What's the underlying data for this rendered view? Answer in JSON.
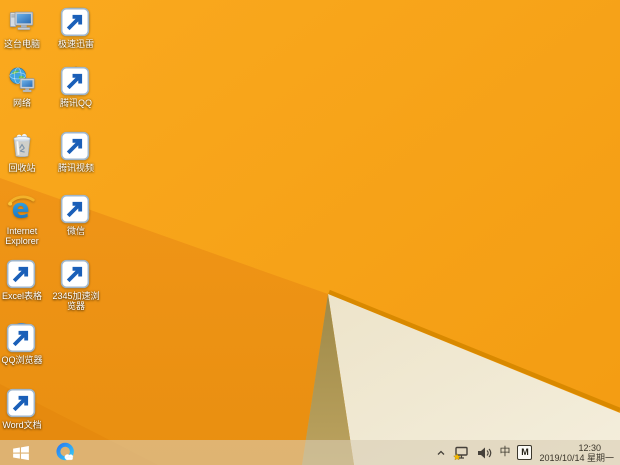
{
  "desktop": {
    "icons": [
      {
        "name": "this-pc",
        "label": "这台电脑"
      },
      {
        "name": "xunlei-thunder",
        "label": "极速迅雷"
      },
      {
        "name": "network",
        "label": "网络"
      },
      {
        "name": "tencent-qq",
        "label": "腾讯QQ"
      },
      {
        "name": "recycle-bin",
        "label": "回收站"
      },
      {
        "name": "tencent-video",
        "label": "腾讯视频"
      },
      {
        "name": "internet-explorer",
        "label": "Internet\nExplorer"
      },
      {
        "name": "wechat",
        "label": "微信"
      },
      {
        "name": "excel-sheet",
        "label": "Excel表格"
      },
      {
        "name": "2345-browser",
        "label": "2345加速浏\n览器"
      },
      {
        "name": "qq-browser",
        "label": "QQ浏览器"
      },
      {
        "name": "word-doc",
        "label": "Word文档"
      }
    ]
  },
  "taskbar": {
    "tray": {
      "ime_mode": "中",
      "ime_badge": "M",
      "time": "12:30",
      "date": "2019/10/14 星期一"
    }
  },
  "colors": {
    "wallpaper_orange_main": "#F7A319",
    "wallpaper_orange_fold": "#EE9213",
    "wallpaper_orange_deep": "#E4880D",
    "wallpaper_cream": "#F0E8D1",
    "wallpaper_shadow_tan": "#AB9251",
    "wallpaper_ridge": "#D98900",
    "taskbar_tint": "rgba(216,205,180,0.6)"
  }
}
